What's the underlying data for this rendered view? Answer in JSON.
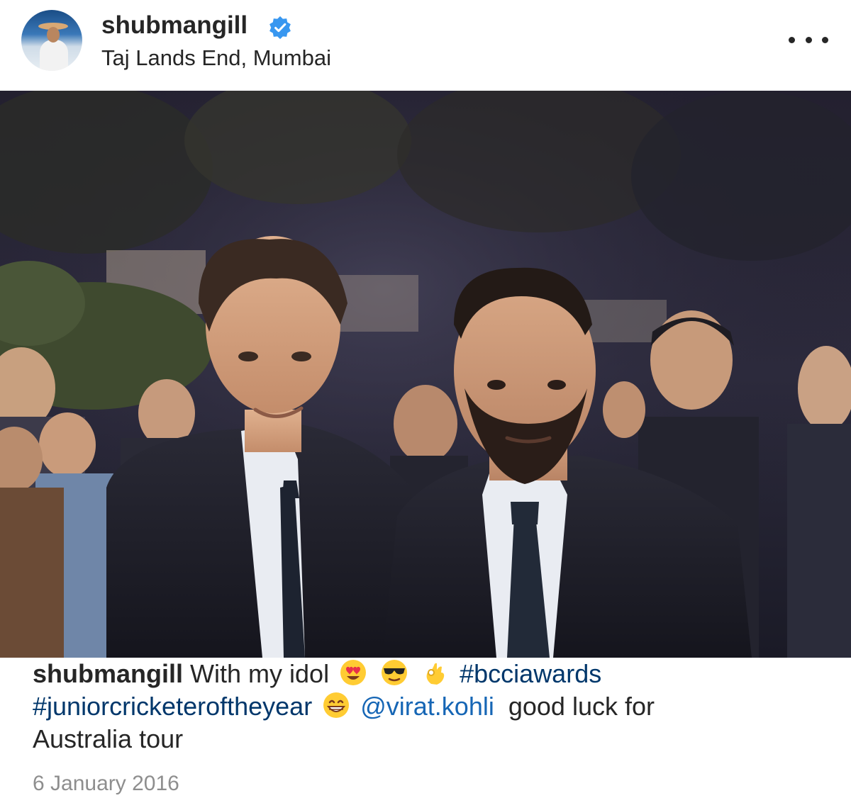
{
  "post": {
    "username": "shubmangill",
    "location": "Taj Lands End, Mumbai",
    "verified_icon": "verified-badge-icon",
    "more_icon": "more-options-icon",
    "photo_description_icon": "post-photo"
  },
  "caption": {
    "username": "shubmangill",
    "text_1": "With my idol",
    "emoji_1": "heart-eyes-emoji",
    "emoji_2": "sunglasses-emoji",
    "emoji_3": "ok-hand-emoji",
    "hashtag_1": "#bcciawards",
    "hashtag_2": "#juniorcricketeroftheyear",
    "emoji_4": "grinning-emoji",
    "mention": "@virat.kohli",
    "text_2": "good luck for",
    "text_3": "Australia tour"
  },
  "date": "6 January 2016",
  "colors": {
    "verified": "#3897f0",
    "link": "#00376b",
    "mention": "#1666b5",
    "date": "#8e8e8e"
  }
}
